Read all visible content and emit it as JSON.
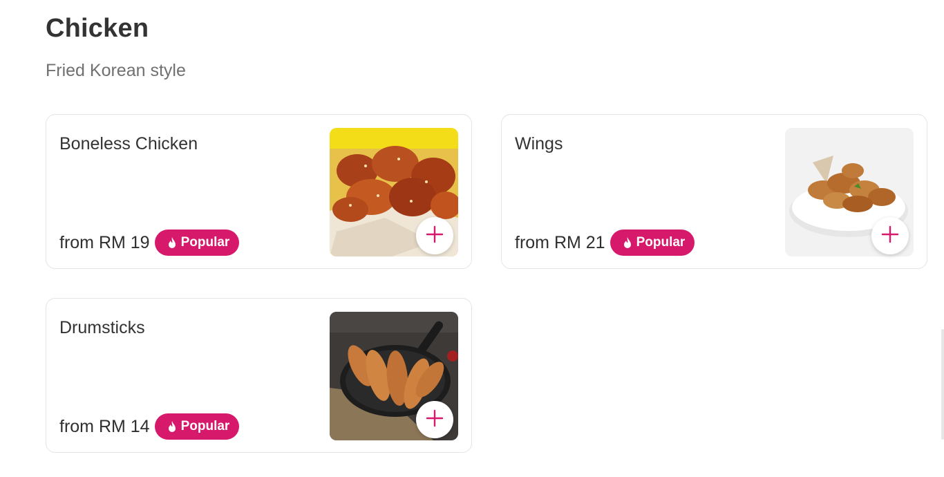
{
  "section": {
    "title": "Chicken",
    "subtitle": "Fried Korean style"
  },
  "accent_color": "#d6196b",
  "items": [
    {
      "name": "Boneless Chicken",
      "price": "from RM 19",
      "badge": "Popular",
      "badge_icon": "flame-icon",
      "add_icon": "plus-icon"
    },
    {
      "name": "Wings",
      "price": "from RM 21",
      "badge": "Popular",
      "badge_icon": "flame-icon",
      "add_icon": "plus-icon"
    },
    {
      "name": "Drumsticks",
      "price": "from RM 14",
      "badge": "Popular",
      "badge_icon": "flame-icon",
      "add_icon": "plus-icon"
    }
  ]
}
